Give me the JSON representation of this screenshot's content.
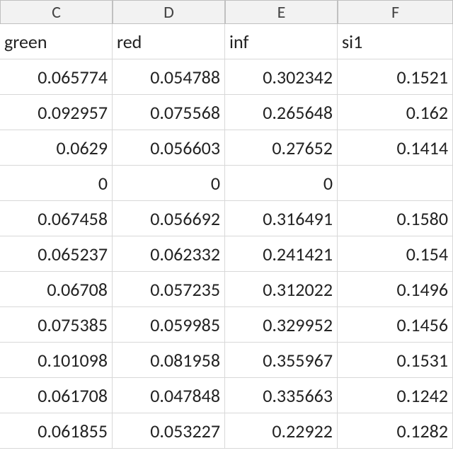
{
  "columns": {
    "C": {
      "letter": "C",
      "header": "green",
      "values": [
        "0.065774",
        "0.092957",
        "0.0629",
        "0",
        "0.067458",
        "0.065237",
        "0.06708",
        "0.075385",
        "0.101098",
        "0.061708",
        "0.061855"
      ]
    },
    "D": {
      "letter": "D",
      "header": "red",
      "values": [
        "0.054788",
        "0.075568",
        "0.056603",
        "0",
        "0.056692",
        "0.062332",
        "0.057235",
        "0.059985",
        "0.081958",
        "0.047848",
        "0.053227"
      ]
    },
    "E": {
      "letter": "E",
      "header": "inf",
      "values": [
        "0.302342",
        "0.265648",
        "0.27652",
        "0",
        "0.316491",
        "0.241421",
        "0.312022",
        "0.329952",
        "0.355967",
        "0.335663",
        "0.22922"
      ]
    },
    "F": {
      "letter": "F",
      "header": "si1",
      "values": [
        "0.1521",
        "0.162",
        "0.1414",
        "",
        "0.1580",
        "0.154",
        "0.1496",
        "0.1456",
        "0.1531",
        "0.1242",
        "0.1282"
      ]
    }
  },
  "layout": {
    "colWidths": {
      "C": 159,
      "D": 159,
      "E": 159,
      "F": 163
    },
    "colX": {
      "C": 0,
      "D": 159,
      "E": 318,
      "F": 477
    },
    "headerRowAlign": "txt",
    "dataRowAlign": "num"
  }
}
